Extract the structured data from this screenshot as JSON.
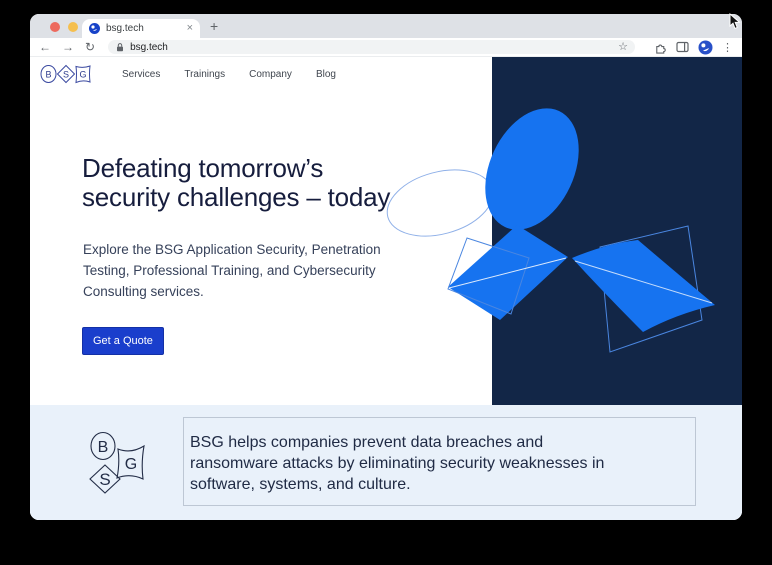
{
  "browser": {
    "tab_title": "bsg.tech",
    "url": "bsg.tech",
    "glyphs": {
      "close_tab": "×",
      "new_tab": "+",
      "back": "←",
      "forward": "→",
      "reload": "↻",
      "bookmark_star": "☆",
      "menu_dots": "⋮"
    }
  },
  "site": {
    "logo_letters": {
      "b": "B",
      "s": "S",
      "g": "G"
    },
    "nav": {
      "items": [
        {
          "label": "Services"
        },
        {
          "label": "Trainings"
        },
        {
          "label": "Company"
        },
        {
          "label": "Blog"
        }
      ]
    },
    "hero": {
      "heading_lines": [
        "Defeating tomorrow’s",
        "security challenges – today"
      ],
      "paragraph_lines": [
        "Explore the BSG Application Security, Penetration",
        "Testing, Professional Training, and Cybersecurity",
        "Consulting services."
      ],
      "cta_label": "Get a Quote"
    },
    "intro": {
      "text_lines": [
        "BSG helps companies prevent data breaches and",
        "ransomware attacks by eliminating security weaknesses in",
        "software, systems, and culture."
      ]
    }
  },
  "colors": {
    "brand_button_blue": "#1a3ecc",
    "shape_blue": "#1673f0",
    "dark_navy_panel": "#122647",
    "intro_background": "#e9f1fa",
    "heading_navy": "#161d3d"
  }
}
